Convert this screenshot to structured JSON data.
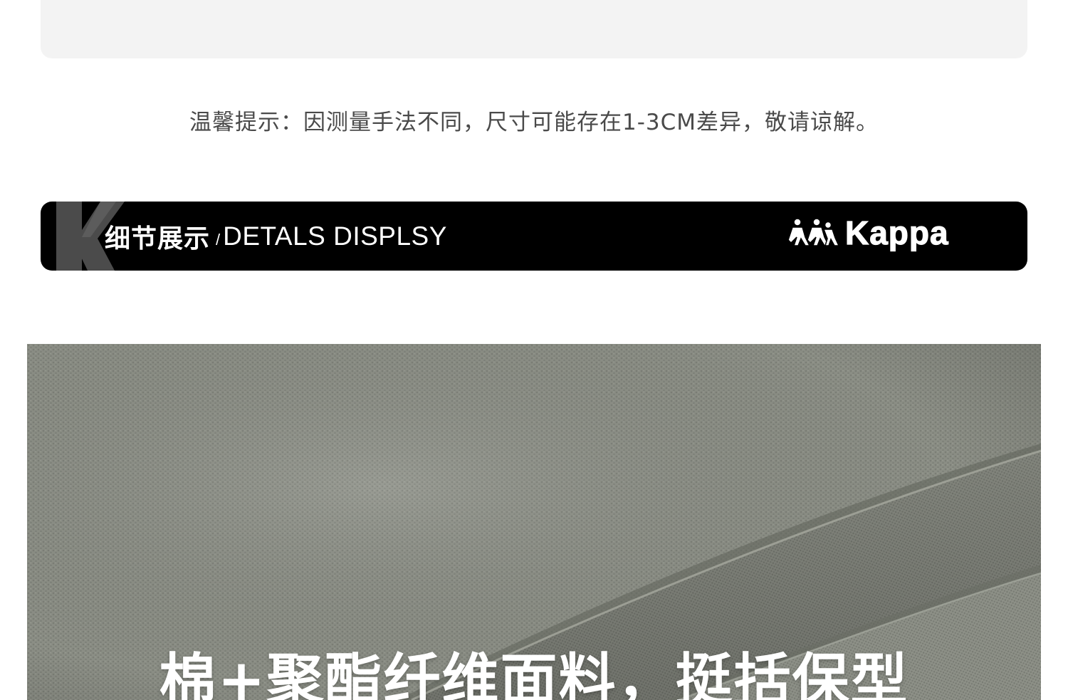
{
  "notice": {
    "text": "温馨提示：因测量手法不同，尺寸可能存在1-3CM差异，敬请谅解。"
  },
  "section_banner": {
    "title_cn": "细节展示",
    "separator": "/",
    "title_en": "DETALS DISPLSY",
    "brand_name": "Kappa",
    "badge_letter": "K"
  },
  "detail_photo": {
    "caption": "棉+聚酯纤维面料，挺括保型",
    "fabric_color": "#8c8f86"
  },
  "colors": {
    "banner_background": "#000000",
    "card_background": "#f3f3f3",
    "notice_text": "#4a4a4a"
  },
  "icons": [
    "kappa-omini-logo-icon",
    "k-letter-decoration-icon"
  ]
}
